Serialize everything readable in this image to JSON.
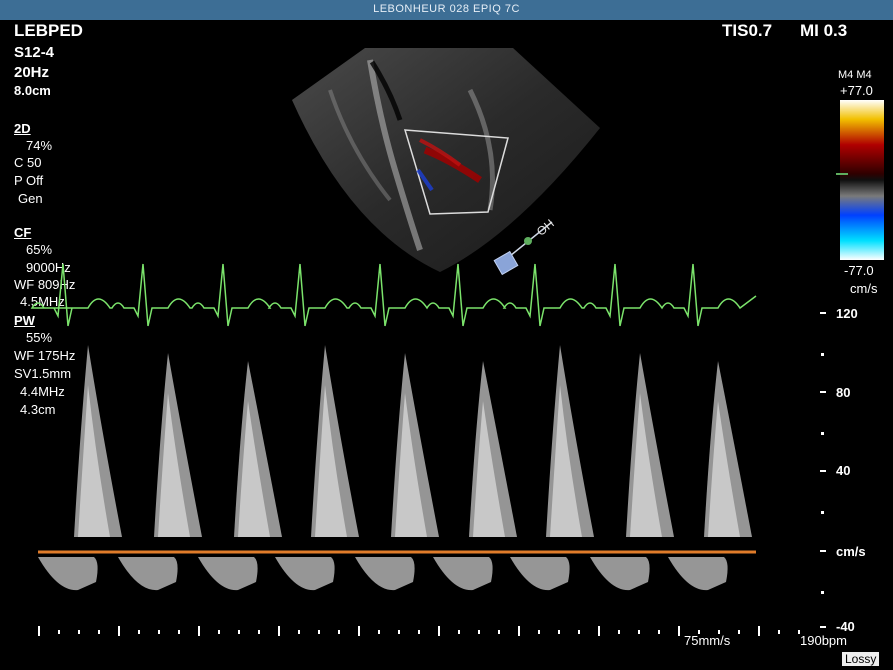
{
  "header": {
    "system": "LEBONHEUR 028   EPIQ 7C",
    "preset": "LEBPED",
    "tis": "TIS0.7",
    "mi": "MI 0.3"
  },
  "probe": {
    "name": "S12-4",
    "frame_rate": "20Hz",
    "depth": "8.0cm"
  },
  "params_2d": {
    "title": "2D",
    "gain": "74%",
    "compression": "C 50",
    "persistence": "P Off",
    "mode": "Gen"
  },
  "params_cf": {
    "title": "CF",
    "gain": "65%",
    "prf": "9000Hz",
    "wall_filter": "WF 809Hz",
    "frequency": "4.5MHz"
  },
  "params_pw": {
    "title": "PW",
    "gain": "55%",
    "wall_filter": "WF 175Hz",
    "sample_volume": "SV1.5mm",
    "frequency": "4.4MHz",
    "gate_depth": "4.3cm"
  },
  "color_bar": {
    "map": "M4 M4",
    "max": "+77.0",
    "min": "-77.0",
    "unit": "cm/s",
    "colors": [
      "#ffffff",
      "#f2c000",
      "#b00000",
      "#300000",
      "#101010",
      "#0040ff",
      "#00e0ff",
      "#ffffff"
    ]
  },
  "velocity_scale": {
    "labels": [
      "120",
      "80",
      "40",
      "cm/s",
      "-40"
    ],
    "unit": "cm/s"
  },
  "sweep_speed": "75mm/s",
  "heart_rate": "190bpm",
  "lossy": "Lossy",
  "colors": {
    "ecg": "#7be36b",
    "baseline": "#e07c2a",
    "header_bar": "#3d6e95"
  }
}
